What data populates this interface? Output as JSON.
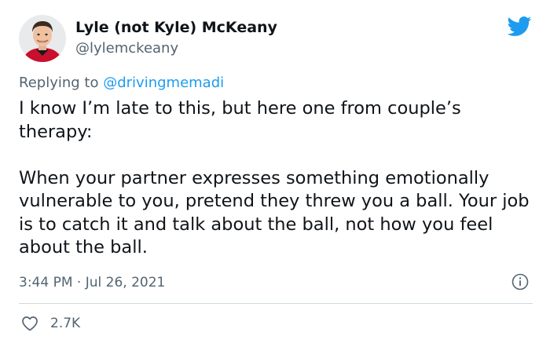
{
  "author": {
    "display_name": "Lyle (not Kyle) McKeany",
    "handle": "@lylemckeany"
  },
  "reply": {
    "prefix": "Replying to",
    "mention": "@drivingmemadi"
  },
  "tweet": {
    "paragraphs": [
      "I know I’m late to this, but here one from couple’s therapy:",
      "When your partner expresses something emotionally vulnerable to you, pretend they threw you a ball. Your job is to catch it and talk about the ball, not how you feel about the ball."
    ],
    "timestamp": "3:44 PM · Jul 26, 2021",
    "likes": "2.7K"
  },
  "icons": {
    "brand": "twitter-bird-icon",
    "info": "info-icon",
    "like": "heart-icon"
  },
  "colors": {
    "brand_blue": "#1d9bf0",
    "text_primary": "#0f1419",
    "text_secondary": "#536471",
    "divider": "#cfd9de"
  }
}
